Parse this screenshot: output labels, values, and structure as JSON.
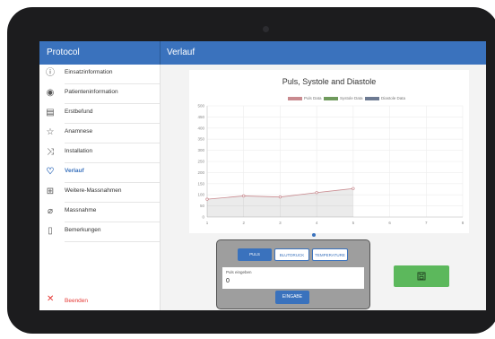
{
  "header": {
    "left_title": "Protocol",
    "right_title": "Verlauf"
  },
  "sidebar": {
    "items": [
      {
        "label": "Einsatzinformation",
        "icon": "info-icon",
        "active": false
      },
      {
        "label": "Patienteninformation",
        "icon": "person-icon",
        "active": false
      },
      {
        "label": "Erstbefund",
        "icon": "clipboard-icon",
        "active": false
      },
      {
        "label": "Anamnese",
        "icon": "star-icon",
        "active": false
      },
      {
        "label": "Installation",
        "icon": "shuffle-icon",
        "active": false
      },
      {
        "label": "Verlauf",
        "icon": "heartbeat-icon",
        "active": true
      },
      {
        "label": "Weitere-Massnahmen",
        "icon": "plus-box-icon",
        "active": false
      },
      {
        "label": "Massnahme",
        "icon": "bandage-icon",
        "active": false
      },
      {
        "label": "Bemerkungen",
        "icon": "document-icon",
        "active": false
      }
    ],
    "exit_label": "Beenden",
    "exit_icon": "close-icon"
  },
  "chart_data": {
    "type": "line",
    "title": "Puls, Systole and Diastole",
    "x": [
      1,
      2,
      3,
      4,
      5,
      6,
      7,
      8
    ],
    "ylim": [
      0,
      500
    ],
    "yticks": [
      0,
      50,
      100,
      150,
      200,
      250,
      300,
      350,
      400,
      450,
      500
    ],
    "grid": true,
    "legend_position": "top",
    "series": [
      {
        "name": "Puls Data",
        "values": [
          80,
          95,
          90,
          110,
          128
        ],
        "color": "#c98a8f"
      },
      {
        "name": "Systole Data",
        "values": [],
        "color": "#6f9a5c"
      },
      {
        "name": "Diastole Data",
        "values": [],
        "color": "#6d7a92"
      }
    ]
  },
  "input_panel": {
    "tabs": [
      "PULS",
      "BLUTDRUCK",
      "TEMPERATURE"
    ],
    "active_tab": 0,
    "field_label": "Puls eingeben",
    "field_value": "0",
    "submit_label": "EINGABE"
  },
  "save_button": {
    "icon": "save-icon",
    "color": "#5cb85c"
  },
  "colors": {
    "accent": "#3a72bd",
    "danger": "#e53935"
  }
}
